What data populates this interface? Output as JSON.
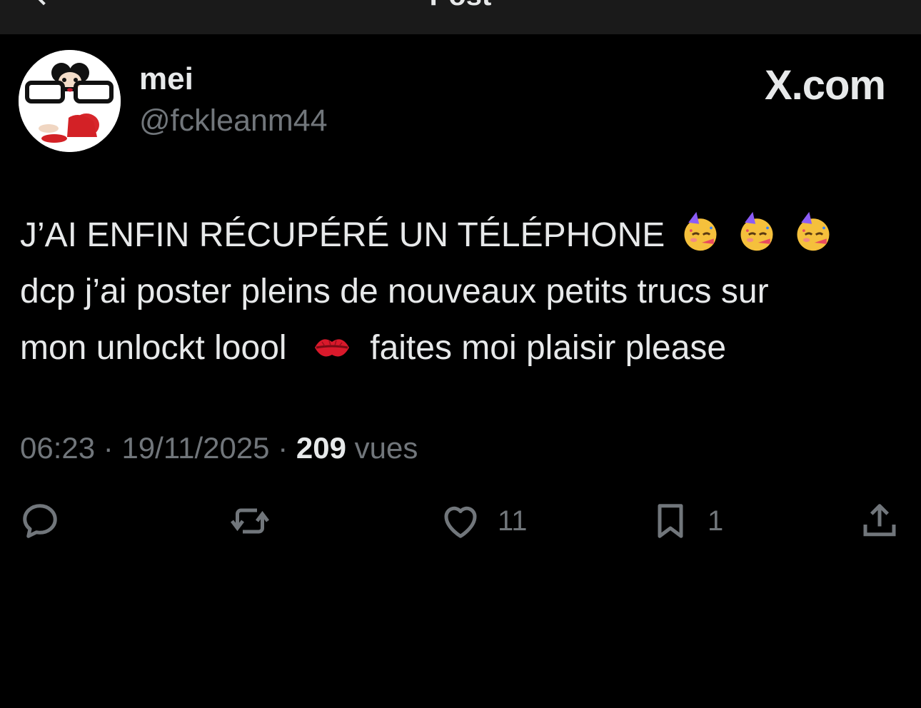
{
  "header": {
    "title": "Post"
  },
  "post": {
    "author": {
      "name": "mei",
      "handle": "@fckleanm44"
    },
    "brand": "X.com",
    "text_lines": [
      "J’AI ENFIN RÉCUPÉRÉ UN TÉLÉPHONE",
      "dcp j’ai poster pleins de nouveaux petits trucs sur",
      "mon unlockt loool",
      "faites moi plaisir please"
    ],
    "emojis": [
      "partying-face-emoji",
      "kiss-mark-emoji"
    ],
    "time": "06:23",
    "date": "19/11/2025",
    "separator": "·",
    "views_count": "209",
    "views_label": "vues",
    "actions": {
      "reply_count": "",
      "repost_count": "",
      "like_count": "11",
      "bookmark_count": "1"
    }
  },
  "colors": {
    "background": "#000000",
    "text": "#e7e9ea",
    "secondary": "#71767b",
    "topbar": "#1a1a1a"
  }
}
